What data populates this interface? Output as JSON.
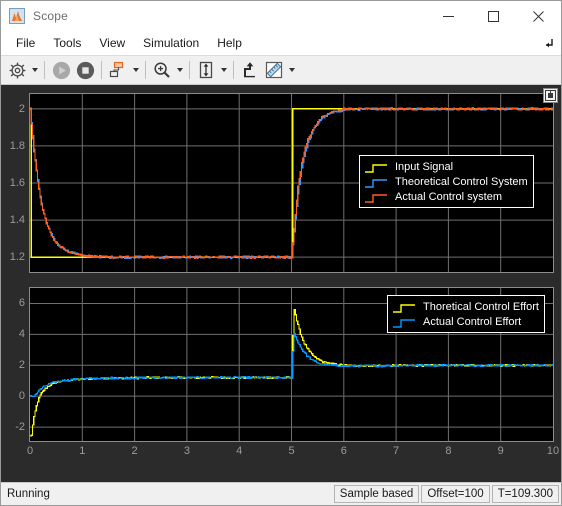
{
  "window": {
    "title": "Scope",
    "icon": "scope-app-icon",
    "minimize_label": "Minimize",
    "maximize_label": "Maximize",
    "close_label": "Close"
  },
  "menubar": {
    "items": [
      {
        "label": "File",
        "name": "menu-file"
      },
      {
        "label": "Tools",
        "name": "menu-tools"
      },
      {
        "label": "View",
        "name": "menu-view"
      },
      {
        "label": "Simulation",
        "name": "menu-simulation"
      },
      {
        "label": "Help",
        "name": "menu-help"
      }
    ],
    "overflow_icon": "menu-overflow-arrow-icon"
  },
  "toolbar": {
    "buttons": [
      {
        "name": "configuration-properties-button",
        "icon": "gear-icon",
        "tooltip": "Configuration Properties",
        "has_caret": true,
        "enabled": true
      },
      {
        "name": "run-button",
        "icon": "play-icon",
        "tooltip": "Run",
        "has_caret": false,
        "enabled": false
      },
      {
        "name": "stop-button",
        "icon": "stop-icon",
        "tooltip": "Stop",
        "has_caret": false,
        "enabled": true
      },
      {
        "name": "layout-button",
        "icon": "subplot-layout-icon",
        "tooltip": "Layout",
        "has_caret": true,
        "enabled": true
      },
      {
        "name": "zoom-in-button",
        "icon": "zoom-in-magnifier-icon",
        "tooltip": "Zoom In",
        "has_caret": true,
        "enabled": true
      },
      {
        "name": "scale-axes-limits-button",
        "icon": "fit-to-view-icon",
        "tooltip": "Scale Axes Limits",
        "has_caret": true,
        "enabled": true
      },
      {
        "name": "highlight-signal-button",
        "icon": "highlight-signal-icon",
        "tooltip": "Highlight Signal to Source",
        "has_caret": false,
        "enabled": true
      },
      {
        "name": "measurements-button",
        "icon": "ruler-measurement-icon",
        "tooltip": "Measurements",
        "has_caret": true,
        "enabled": true
      }
    ]
  },
  "scope": {
    "maximize_axes_button": "maximize-axes-icon",
    "colors": {
      "background": "#000000",
      "grid": "#707070",
      "axis_text": "#9b9b9b",
      "input_signal": "#ffff00",
      "theoretical": "#3399ff",
      "actual": "#ff6020",
      "theoretical_effort": "#ffff00",
      "actual_effort": "#0099ff"
    }
  },
  "chart_data": [
    {
      "name": "top-plot",
      "type": "line",
      "title": "",
      "xlabel": "",
      "ylabel": "",
      "xlim": [
        0,
        10
      ],
      "ylim": [
        1.12,
        2.08
      ],
      "xticks": [
        0,
        1,
        2,
        3,
        4,
        5,
        6,
        7,
        8,
        9,
        10
      ],
      "xticklabels": [
        "0",
        "1",
        "2",
        "3",
        "4",
        "5",
        "6",
        "7",
        "8",
        "9",
        "10"
      ],
      "yticks": [
        1.2,
        1.4,
        1.6,
        1.8,
        2
      ],
      "yticklabels": [
        "1.2",
        "1.4",
        "1.6",
        "1.8",
        "2"
      ],
      "grid": true,
      "legend_position": "middle-right",
      "series": [
        {
          "name": "Input Signal",
          "color": "#ffff00",
          "x": [
            0,
            0.02,
            5,
            5.02,
            10
          ],
          "y": [
            2,
            1.2,
            1.2,
            2,
            2
          ]
        },
        {
          "name": "Theoretical Control System",
          "color": "#3399ff",
          "x": [
            0,
            0.08,
            0.16,
            0.24,
            0.34,
            0.44,
            0.56,
            0.7,
            0.88,
            1.1,
            1.5,
            2.5,
            3.5,
            4.5,
            5.0,
            5.06,
            5.12,
            5.2,
            5.3,
            5.42,
            5.56,
            5.74,
            6.0,
            6.5,
            7.5,
            8.5,
            10
          ],
          "y": [
            2.0,
            1.76,
            1.58,
            1.45,
            1.36,
            1.3,
            1.26,
            1.235,
            1.218,
            1.205,
            1.2,
            1.2,
            1.2,
            1.2,
            1.2,
            1.37,
            1.55,
            1.7,
            1.81,
            1.89,
            1.945,
            1.975,
            1.995,
            2.0,
            2.0,
            2.0,
            2.0
          ]
        },
        {
          "name": "Actual Control system",
          "color": "#ff6020",
          "x": [
            0,
            0.06,
            0.14,
            0.22,
            0.32,
            0.42,
            0.54,
            0.68,
            0.86,
            1.08,
            1.5,
            2.5,
            3.5,
            4.5,
            5.0,
            5.06,
            5.12,
            5.2,
            5.3,
            5.42,
            5.56,
            5.74,
            6.0,
            6.5,
            7.5,
            8.5,
            10
          ],
          "y": [
            2.0,
            1.8,
            1.61,
            1.47,
            1.375,
            1.305,
            1.263,
            1.237,
            1.219,
            1.206,
            1.2,
            1.2,
            1.2,
            1.2,
            1.2,
            1.4,
            1.58,
            1.725,
            1.83,
            1.9,
            1.95,
            1.98,
            2.0,
            2.0,
            2.0,
            2.0,
            2.0
          ]
        }
      ],
      "legend": [
        {
          "label": "Input Signal",
          "color": "#ffff00"
        },
        {
          "label": "Theoretical Control System",
          "color": "#3399ff"
        },
        {
          "label": "Actual Control system",
          "color": "#ff6020"
        }
      ]
    },
    {
      "name": "bottom-plot",
      "type": "line",
      "title": "",
      "xlabel": "",
      "ylabel": "",
      "xlim": [
        0,
        10
      ],
      "ylim": [
        -2.9,
        7.0
      ],
      "xticks": [
        0,
        1,
        2,
        3,
        4,
        5,
        6,
        7,
        8,
        9,
        10
      ],
      "xticklabels": [
        "0",
        "1",
        "2",
        "3",
        "4",
        "5",
        "6",
        "7",
        "8",
        "9",
        "10"
      ],
      "yticks": [
        -2,
        0,
        2,
        4,
        6
      ],
      "yticklabels": [
        "-2",
        "0",
        "2",
        "4",
        "6"
      ],
      "grid": true,
      "legend_position": "top-right",
      "series": [
        {
          "name": "Thoretical Control Effort",
          "color": "#ffff00",
          "x": [
            0,
            0.02,
            0.06,
            0.1,
            0.14,
            0.2,
            0.28,
            0.38,
            0.5,
            0.64,
            0.82,
            1.05,
            1.35,
            1.8,
            2.5,
            3.5,
            4.5,
            5.0,
            5.04,
            5.1,
            5.16,
            5.24,
            5.34,
            5.46,
            5.62,
            5.82,
            6.1,
            6.6,
            7.5,
            8.5,
            10
          ],
          "y": [
            -2.6,
            -2.6,
            -1.55,
            -0.9,
            -0.35,
            0.12,
            0.48,
            0.72,
            0.9,
            1.0,
            1.07,
            1.12,
            1.16,
            1.18,
            1.2,
            1.2,
            1.2,
            1.2,
            5.8,
            4.8,
            4.1,
            3.4,
            2.85,
            2.45,
            2.2,
            2.05,
            1.98,
            1.97,
            2.0,
            2.0,
            2.0
          ]
        },
        {
          "name": "Actual Control Effort",
          "color": "#0099ff",
          "x": [
            0,
            0.04,
            0.08,
            0.13,
            0.19,
            0.27,
            0.37,
            0.49,
            0.63,
            0.81,
            1.04,
            1.34,
            1.8,
            2.5,
            3.5,
            4.5,
            5.0,
            5.04,
            5.1,
            5.18,
            5.28,
            5.4,
            5.55,
            5.75,
            6.05,
            6.6,
            7.5,
            8.5,
            10
          ],
          "y": [
            0.0,
            0.0,
            0.05,
            0.22,
            0.45,
            0.63,
            0.8,
            0.93,
            1.02,
            1.08,
            1.13,
            1.16,
            1.18,
            1.2,
            1.2,
            1.2,
            1.2,
            4.1,
            3.6,
            3.1,
            2.65,
            2.3,
            2.1,
            2.0,
            1.95,
            1.96,
            2.0,
            2.0,
            2.0
          ]
        }
      ],
      "legend": [
        {
          "label": "Thoretical Control Effort",
          "color": "#ffff00"
        },
        {
          "label": "Actual Control Effort",
          "color": "#0099ff"
        }
      ]
    }
  ],
  "statusbar": {
    "state": "Running",
    "panels": [
      {
        "name": "status-sample-mode",
        "text": "Sample based"
      },
      {
        "name": "status-offset",
        "text": "Offset=100"
      },
      {
        "name": "status-time",
        "text": "T=109.300"
      }
    ]
  }
}
